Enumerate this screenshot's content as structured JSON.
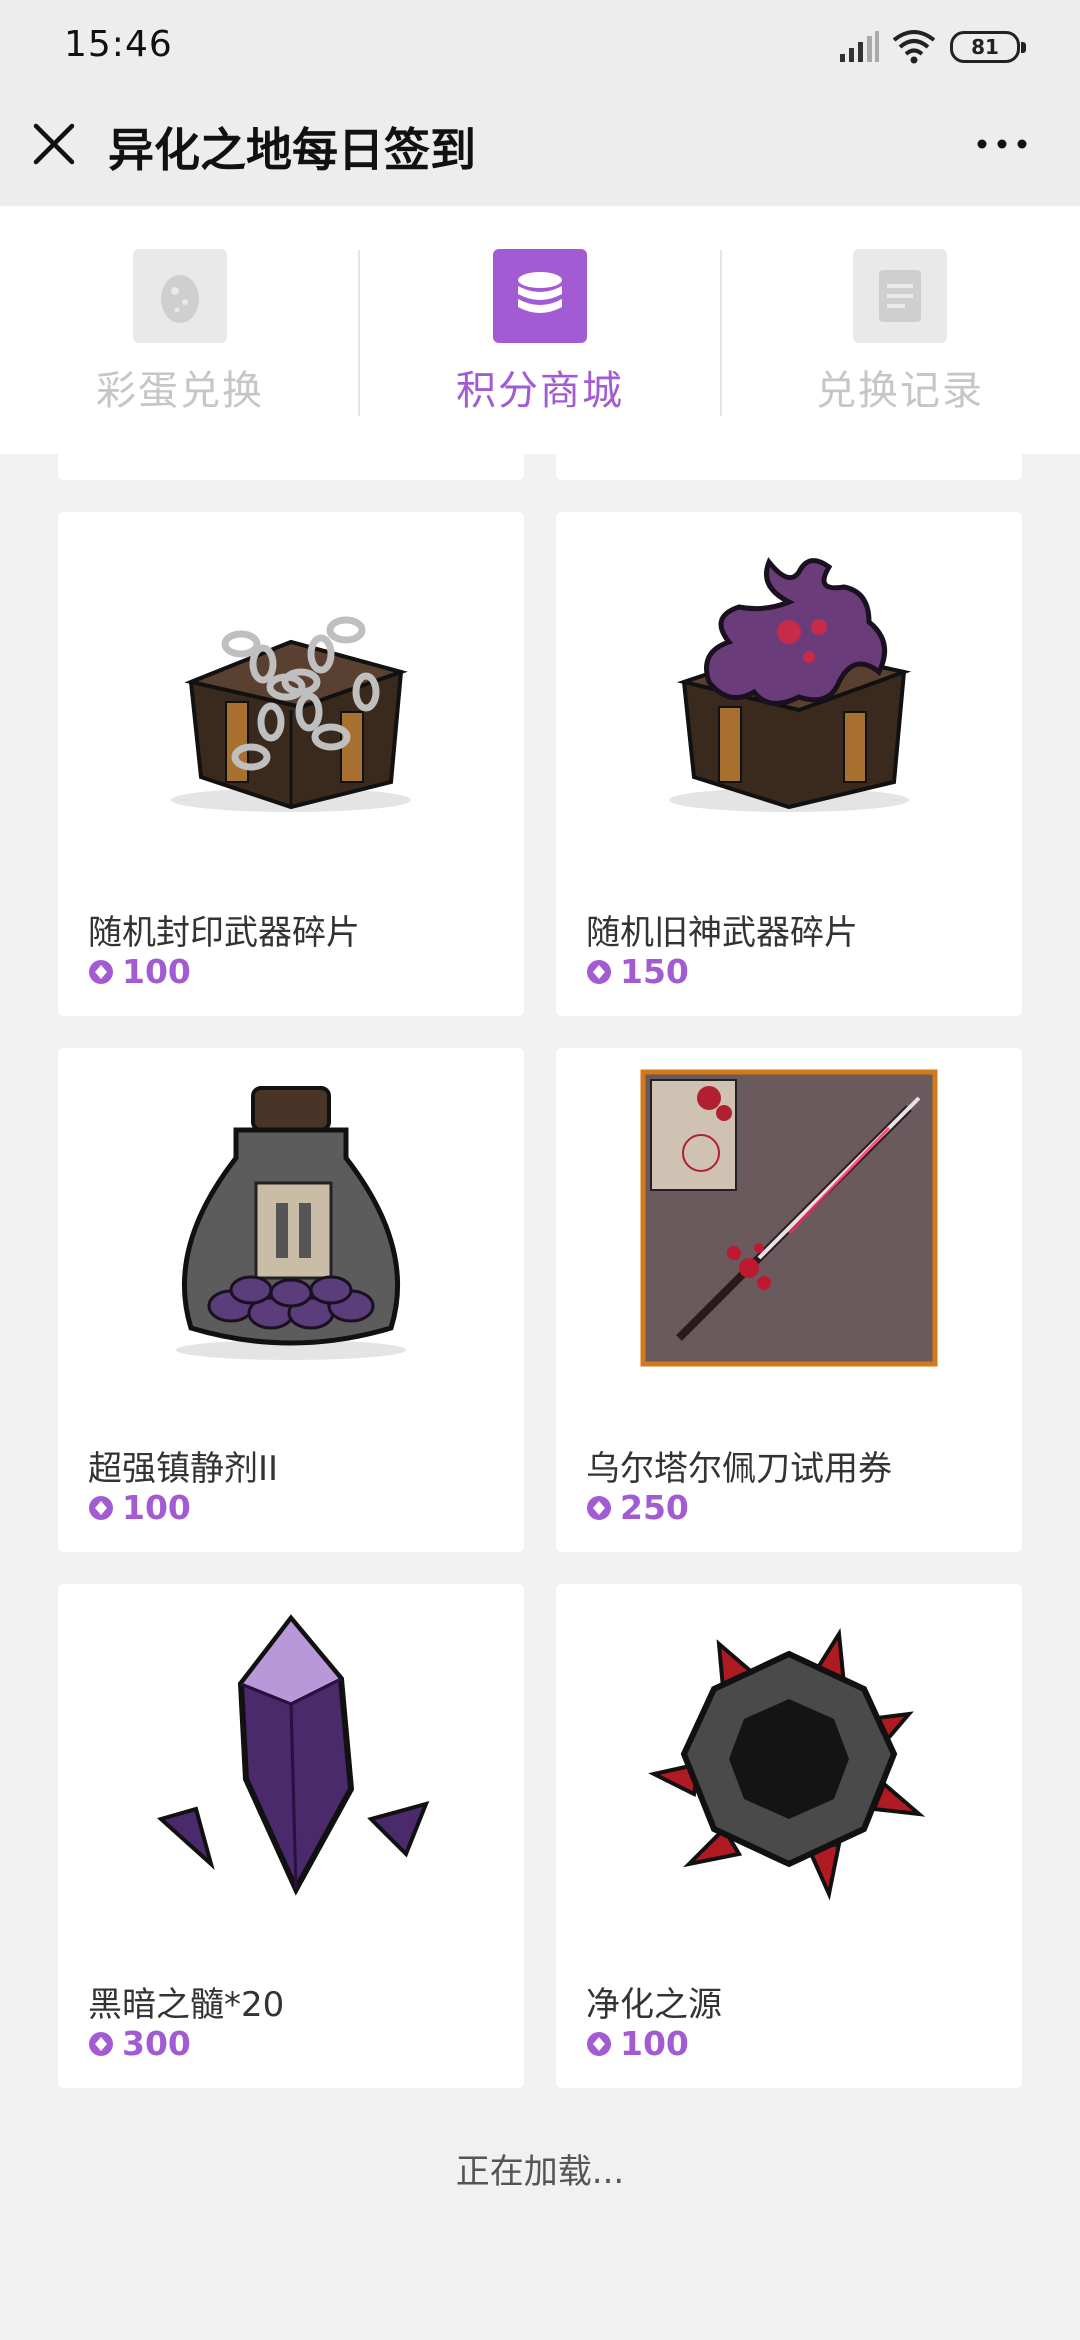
{
  "status_bar": {
    "time": "15:46",
    "battery": "81",
    "icons": [
      "signal-icon",
      "wifi-icon",
      "battery-icon"
    ]
  },
  "header": {
    "title": "异化之地每日签到",
    "close_icon": "close-icon",
    "more_icon": "more-icon"
  },
  "tabs": [
    {
      "label": "彩蛋兑换",
      "icon": "egg-icon",
      "active": false
    },
    {
      "label": "积分商城",
      "icon": "coins-stack-icon",
      "active": true
    },
    {
      "label": "兑换记录",
      "icon": "document-icon",
      "active": false
    }
  ],
  "items": [
    {
      "name": "随机封印武器碎片",
      "price": "100",
      "image": "chained-chest-image"
    },
    {
      "name": "随机旧神武器碎片",
      "price": "150",
      "image": "tentacle-chest-image"
    },
    {
      "name": "超强镇静剂II",
      "price": "100",
      "image": "sedative-bottle-image"
    },
    {
      "name": "乌尔塔尔佩刀试用券",
      "price": "250",
      "image": "blade-voucher-image"
    },
    {
      "name": "黑暗之髓*20",
      "price": "300",
      "image": "dark-crystal-image"
    },
    {
      "name": "净化之源",
      "price": "100",
      "image": "purify-source-image"
    }
  ],
  "loading_text": "正在加载...",
  "colors": {
    "accent": "#a35bd3",
    "background": "#f1f1f1",
    "tab_inactive": "#c6c6c6"
  }
}
